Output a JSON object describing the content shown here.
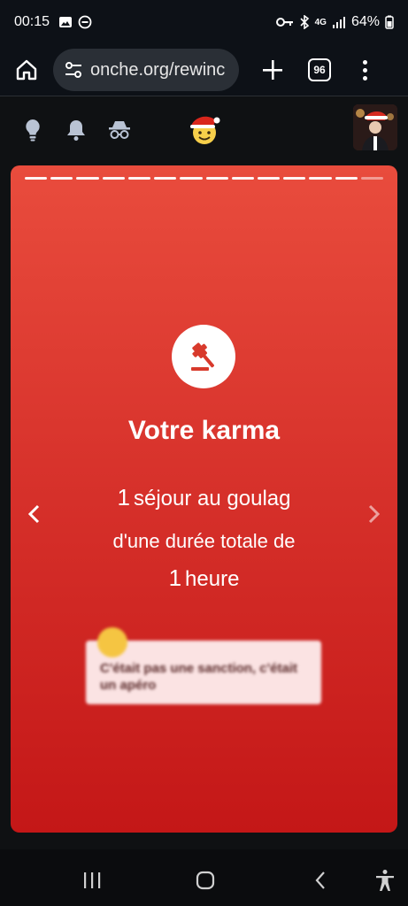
{
  "status": {
    "time": "00:15",
    "network": "4G",
    "battery": "64%"
  },
  "browser": {
    "url": "onche.org/rewinc",
    "tab_count": "96"
  },
  "card": {
    "title": "Votre karma",
    "line1_number": "1",
    "line1_text": "séjour au goulag",
    "line2_text": "d'une durée totale de",
    "line3_number": "1",
    "line3_text": "heure",
    "quote_text": "C'était pas une sanction, c'était un apéro",
    "progress_segments": 14,
    "progress_current": 14
  },
  "icons": {
    "header": [
      "lightbulb-icon",
      "bell-icon",
      "incognito-icon",
      "santa-smiley-icon"
    ],
    "nav": [
      "chevron-left-icon",
      "chevron-right-icon"
    ]
  }
}
